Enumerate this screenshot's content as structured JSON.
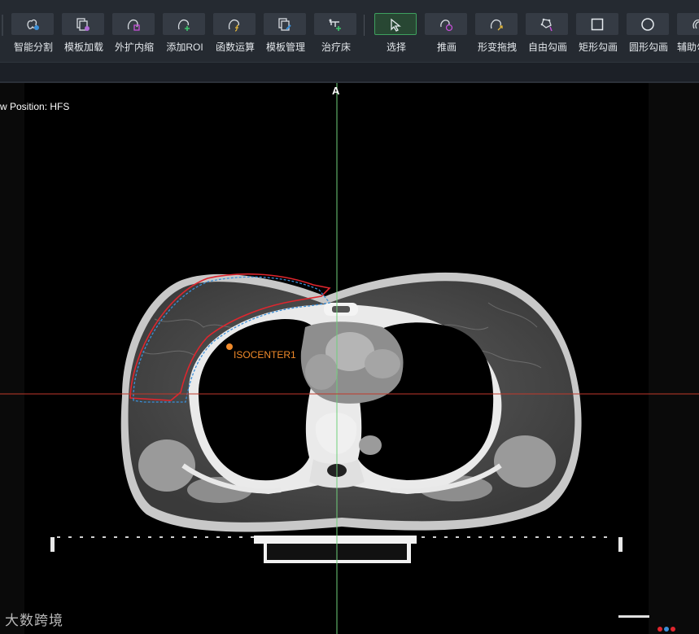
{
  "toolbar": {
    "items": [
      {
        "label": "智能分割",
        "icon": "smart-segment-icon"
      },
      {
        "label": "模板加载",
        "icon": "template-load-icon"
      },
      {
        "label": "外扩内缩",
        "icon": "expand-shrink-icon"
      },
      {
        "label": "添加ROI",
        "icon": "add-roi-icon"
      },
      {
        "label": "函数运算",
        "icon": "function-op-icon"
      },
      {
        "label": "模板管理",
        "icon": "template-manage-icon"
      },
      {
        "label": "治疗床",
        "icon": "treatment-couch-icon"
      },
      {
        "label": "选择",
        "icon": "select-cursor-icon",
        "active": true
      },
      {
        "label": "推画",
        "icon": "push-draw-icon"
      },
      {
        "label": "形变拖拽",
        "icon": "deform-drag-icon"
      },
      {
        "label": "自由勾画",
        "icon": "freehand-draw-icon"
      },
      {
        "label": "矩形勾画",
        "icon": "rectangle-draw-icon"
      },
      {
        "label": "圆形勾画",
        "icon": "circle-draw-icon"
      },
      {
        "label": "辅助勾",
        "icon": "assist-draw-icon"
      }
    ]
  },
  "viewer": {
    "view_position": "w Position: HFS",
    "orientation_top": "A",
    "isocenter_label": "ISOCENTER1",
    "crosshair_v_color": "#6fcf7a",
    "crosshair_h_color": "#c0392b",
    "contour_red": "#e0262e",
    "contour_blue": "#3a8fd8",
    "isocenter_color": "#f08a2a"
  },
  "watermark": "大数跨境",
  "colors": {
    "toolbar_bg": "#252a31",
    "button_bg": "#353b44",
    "active_border": "#3ea05f"
  }
}
